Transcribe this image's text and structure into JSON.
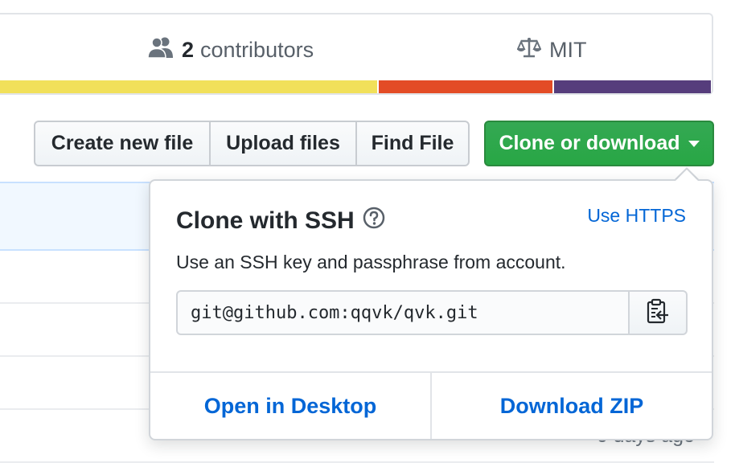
{
  "summary": {
    "contributors_count": "2",
    "contributors_label": "contributors",
    "contributors_icon": "people-icon",
    "license_label": "MIT",
    "license_icon": "law-scale-icon",
    "language_colors": [
      "#f1e05a",
      "#e34c26",
      "#563d7c"
    ]
  },
  "toolbar": {
    "create_label": "Create new file",
    "upload_label": "Upload files",
    "find_label": "Find File",
    "clone_label": "Clone or download"
  },
  "file_list": {
    "row_age": "6 days ago"
  },
  "clone_panel": {
    "title": "Clone with SSH",
    "help_icon": "question-circle-icon",
    "switch_label": "Use HTTPS",
    "description": "Use an SSH key and passphrase from account.",
    "url_value": "git@github.com:qqvk/qvk.git",
    "copy_icon": "clipboard-icon",
    "open_desktop_label": "Open in Desktop",
    "download_zip_label": "Download ZIP"
  },
  "colors": {
    "accent_blue": "#0366d6",
    "clone_green": "#28a745"
  }
}
